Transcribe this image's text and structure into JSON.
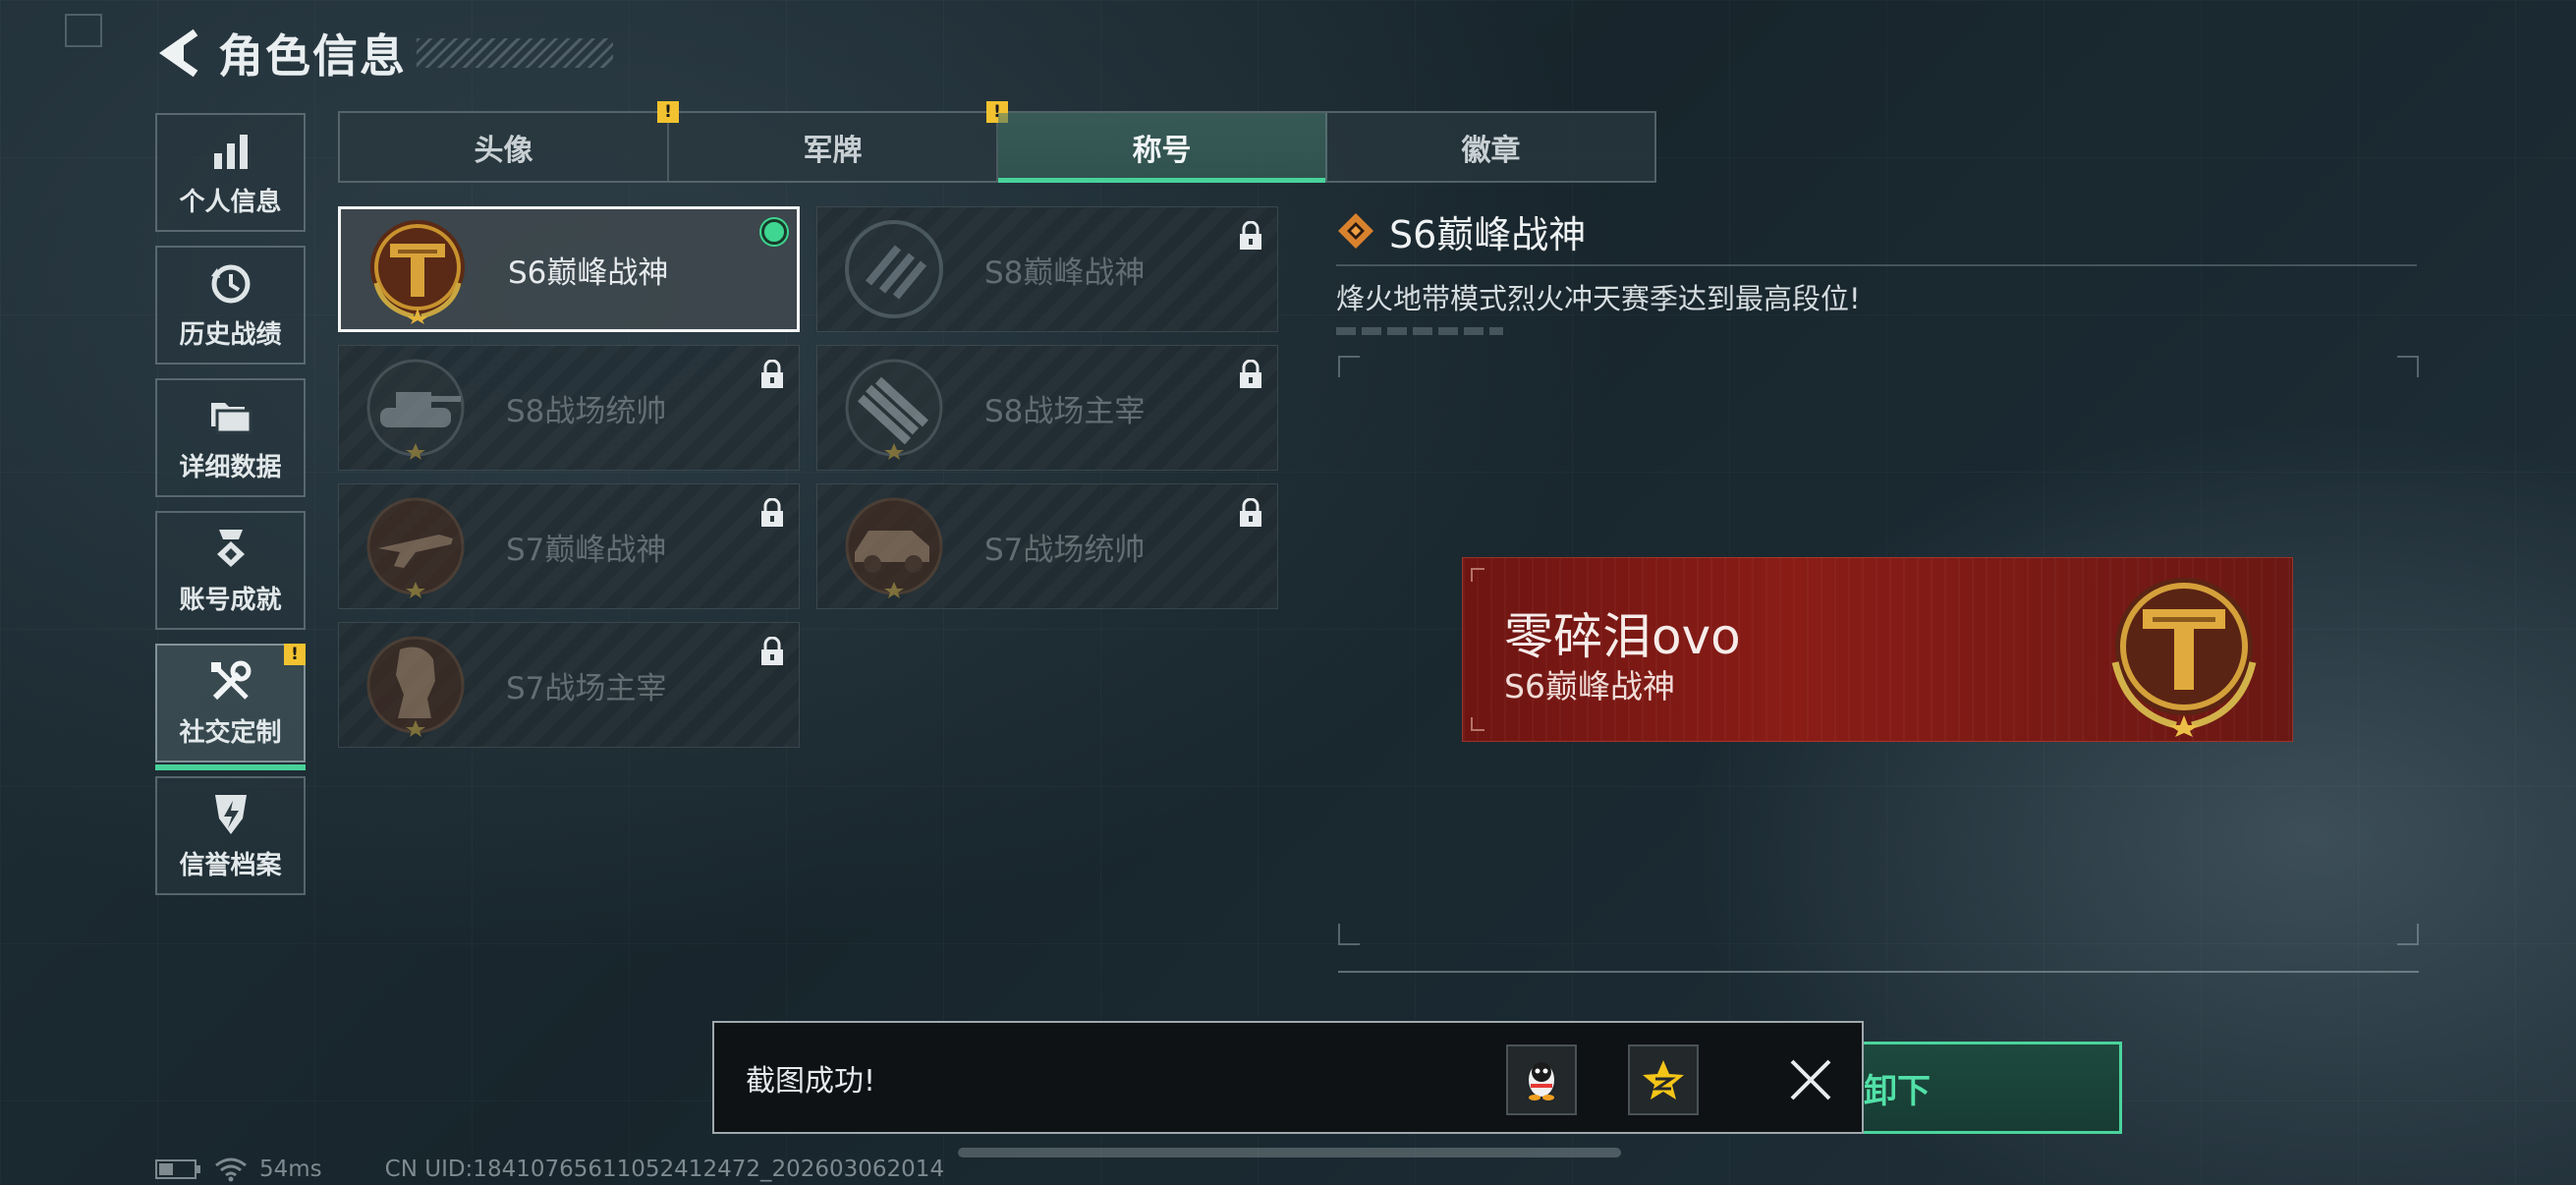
{
  "header": {
    "title": "角色信息"
  },
  "sidebar": {
    "items": [
      {
        "label": "个人信息",
        "icon": "bar-chart-icon"
      },
      {
        "label": "历史战绩",
        "icon": "history-clock-icon"
      },
      {
        "label": "详细数据",
        "icon": "folders-icon"
      },
      {
        "label": "账号成就",
        "icon": "achievement-medal-icon"
      },
      {
        "label": "社交定制",
        "icon": "tools-icon",
        "active": true,
        "badge": "!"
      },
      {
        "label": "信誉档案",
        "icon": "credit-shield-icon"
      }
    ]
  },
  "tabs": [
    {
      "label": "头像",
      "badge": "!"
    },
    {
      "label": "军牌",
      "badge": "!"
    },
    {
      "label": "称号",
      "active": true
    },
    {
      "label": "徽章"
    }
  ],
  "titles": [
    {
      "label": "S6巅峰战神",
      "state": "equipped"
    },
    {
      "label": "S8巅峰战神",
      "state": "locked"
    },
    {
      "label": "S8战场统帅",
      "state": "locked"
    },
    {
      "label": "S8战场主宰",
      "state": "locked"
    },
    {
      "label": "S7巅峰战神",
      "state": "locked"
    },
    {
      "label": "S7战场统帅",
      "state": "locked"
    },
    {
      "label": "S7战场主宰",
      "state": "locked"
    }
  ],
  "detail": {
    "title": "S6巅峰战神",
    "description": "烽火地带模式烈火冲天赛季达到最高段位!"
  },
  "nameplate": {
    "player_name": "零碎泪ovo",
    "title": "S6巅峰战神"
  },
  "action": {
    "unequip_label": "卸下"
  },
  "toast": {
    "message": "截图成功!"
  },
  "status_bar": {
    "ping": "54ms",
    "uid": "CN UID:18410765611052412472_202603062014"
  },
  "colors": {
    "accent_green": "#48d29a",
    "warning_yellow": "#f2c230",
    "nameplate_red": "#8a1c16",
    "gold": "#c8922e"
  }
}
